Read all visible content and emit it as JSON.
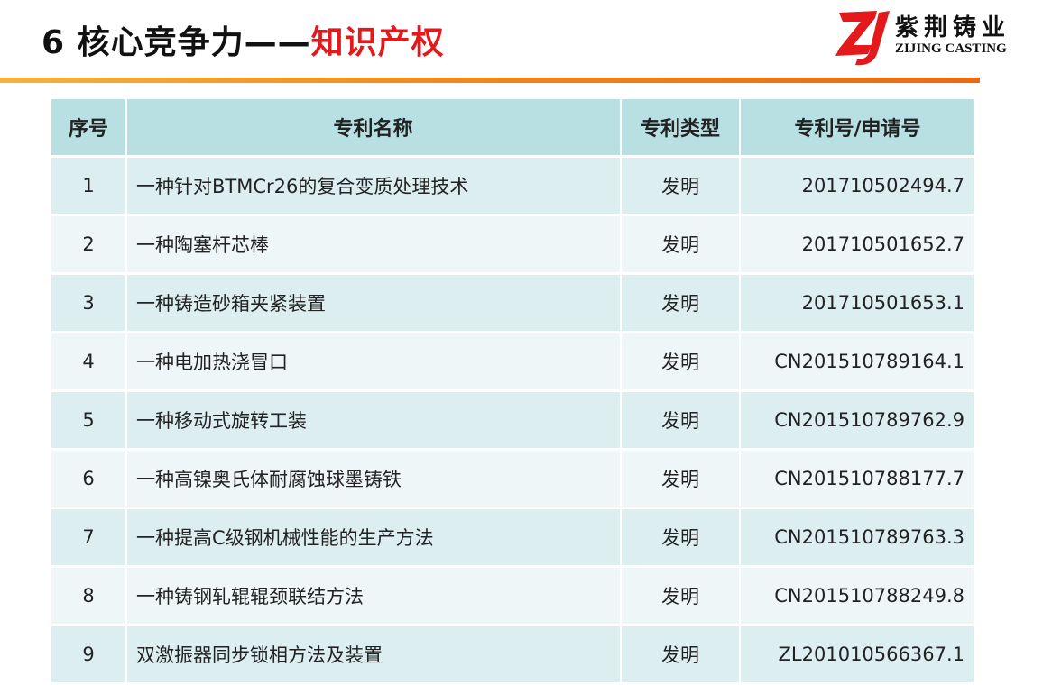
{
  "header": {
    "title_prefix": "6 核心竞争力——",
    "title_accent": "知识产权"
  },
  "logo": {
    "mark": "ZJ",
    "cn": "紫荆铸业",
    "en": "ZIJING CASTING"
  },
  "table": {
    "columns": [
      "序号",
      "专利名称",
      "专利类型",
      "专利号/申请号"
    ],
    "rows": [
      {
        "idx": "1",
        "name": "一种针对BTMCr26的复合变质处理技术",
        "type": "发明",
        "number": "201710502494.7"
      },
      {
        "idx": "2",
        "name": "一种陶塞杆芯棒",
        "type": "发明",
        "number": "201710501652.7"
      },
      {
        "idx": "3",
        "name": "一种铸造砂箱夹紧装置",
        "type": "发明",
        "number": "201710501653.1"
      },
      {
        "idx": "4",
        "name": "一种电加热浇冒口",
        "type": "发明",
        "number": "CN201510789164.1"
      },
      {
        "idx": "5",
        "name": "一种移动式旋转工装",
        "type": "发明",
        "number": "CN201510789762.9"
      },
      {
        "idx": "6",
        "name": "一种高镍奥氏体耐腐蚀球墨铸铁",
        "type": "发明",
        "number": "CN201510788177.7"
      },
      {
        "idx": "7",
        "name": "一种提高C级钢机械性能的生产方法",
        "type": "发明",
        "number": "CN201510789763.3"
      },
      {
        "idx": "8",
        "name": "一种铸钢轧辊辊颈联结方法",
        "type": "发明",
        "number": "CN201510788249.8"
      },
      {
        "idx": "9",
        "name": "双激振器同步锁相方法及装置",
        "type": "发明",
        "number": "ZL201010566367.1"
      }
    ]
  }
}
